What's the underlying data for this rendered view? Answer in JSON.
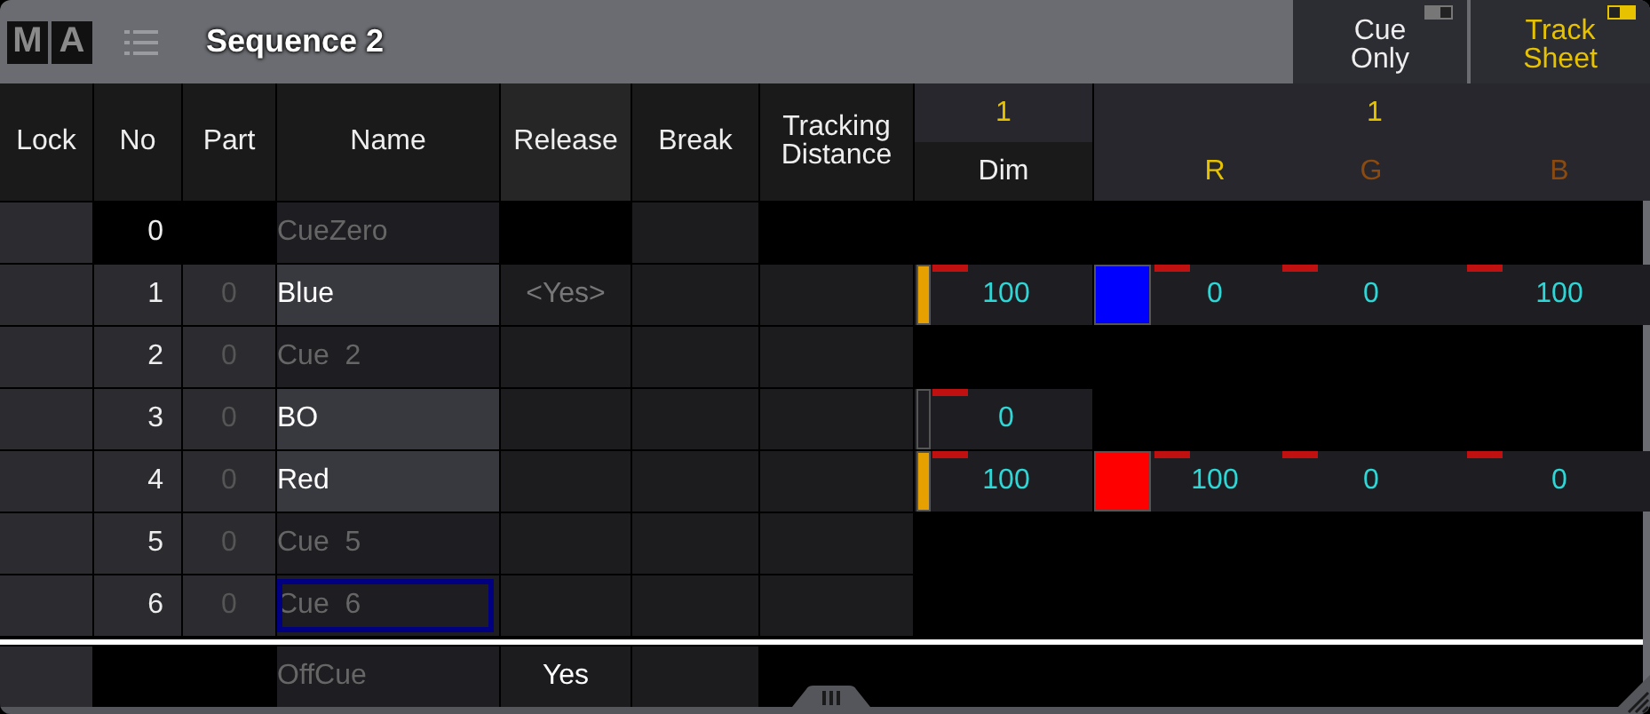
{
  "window": {
    "logo": [
      "M",
      "A"
    ],
    "title": "Sequence 2"
  },
  "toggles": [
    {
      "label": "Cue Only",
      "on": false
    },
    {
      "label": "Track Sheet",
      "on": true
    }
  ],
  "columns": [
    "Lock",
    "No",
    "Part",
    "Name",
    "Release",
    "Break",
    "Tracking Distance"
  ],
  "fixture_groups": [
    {
      "id": "1",
      "attributes": [
        "Dim"
      ]
    },
    {
      "id": "1",
      "attributes": [
        "R",
        "G",
        "B"
      ]
    }
  ],
  "cues": [
    {
      "no": "0",
      "name": "CueZero",
      "active": false,
      "selected": false,
      "kind": "zero"
    },
    {
      "no": "1",
      "part": "0",
      "name": "Blue",
      "active": true,
      "selected": false,
      "release": "<Yes>",
      "kind": "cue",
      "tracking": {
        "dim": "100",
        "level": 1,
        "color": "#0000ff",
        "rgb": [
          "0",
          "0",
          "100"
        ]
      }
    },
    {
      "no": "2",
      "part": "0",
      "name": "Cue  2",
      "active": false,
      "selected": false,
      "kind": "cue"
    },
    {
      "no": "3",
      "part": "0",
      "name": "BO",
      "active": true,
      "selected": false,
      "kind": "cue",
      "tracking": {
        "dim": "0",
        "level": 0
      }
    },
    {
      "no": "4",
      "part": "0",
      "name": "Red",
      "active": true,
      "selected": false,
      "kind": "cue",
      "tracking": {
        "dim": "100",
        "level": 1,
        "color": "#ff0000",
        "rgb": [
          "100",
          "0",
          "0"
        ]
      }
    },
    {
      "no": "5",
      "part": "0",
      "name": "Cue  5",
      "active": false,
      "selected": false,
      "kind": "cue"
    },
    {
      "no": "6",
      "part": "0",
      "name": "Cue  6",
      "active": false,
      "selected": true,
      "kind": "cue"
    }
  ],
  "off_cue": {
    "name": "OffCue",
    "release": "Yes"
  }
}
